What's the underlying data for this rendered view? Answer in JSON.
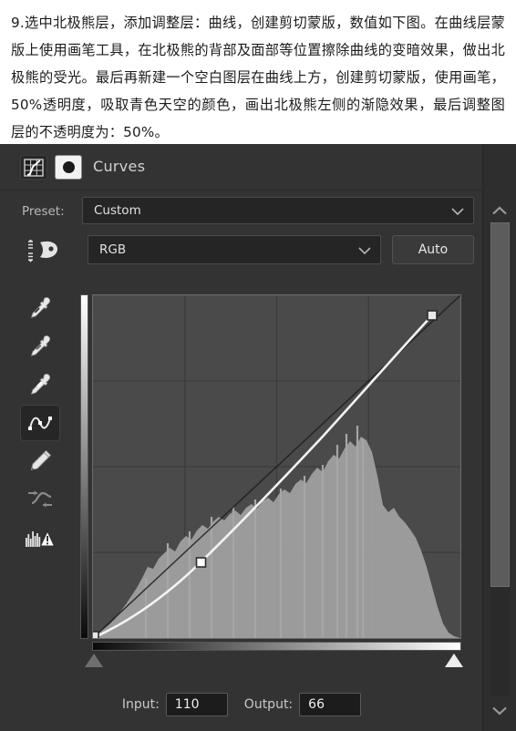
{
  "tutorial": {
    "body": "9.选中北极熊层，添加调整层：曲线，创建剪切蒙版，数值如下图。在曲线层蒙版上使用画笔工具，在北极熊的背部及面部等位置擦除曲线的变暗效果，做出北极熊的受光。最后再新建一个空白图层在曲线上方，创建剪切蒙版，使用画笔，50%透明度，吸取青色天空的颜色，画出北极熊左侧的渐隐效果，最后调整图层的不透明度为：50%。"
  },
  "panel": {
    "title": "Curves",
    "type_icon": "curves-adjustment-icon",
    "mask_thumb": "layer-mask-thumbnail"
  },
  "preset": {
    "label": "Preset:",
    "value": "Custom",
    "chevron": "chevron-down-icon"
  },
  "channel": {
    "icon": "curve-channel-icon",
    "value": "RGB",
    "chevron": "chevron-down-icon",
    "auto_label": "Auto"
  },
  "toolbar": {
    "tools": [
      {
        "name": "black-point-eyedropper-icon",
        "active": false
      },
      {
        "name": "gray-point-eyedropper-icon",
        "active": false
      },
      {
        "name": "white-point-eyedropper-icon",
        "active": false
      },
      {
        "name": "edit-points-curve-icon",
        "active": true
      },
      {
        "name": "pencil-draw-curve-icon",
        "active": false
      },
      {
        "name": "smooth-curve-icon",
        "active": false
      },
      {
        "name": "histogram-warning-icon",
        "active": false
      }
    ]
  },
  "graph": {
    "black_slider": "black-input-slider",
    "white_slider": "white-input-slider",
    "v_gradient": "output-gradient-bar",
    "h_gradient": "input-gradient-bar"
  },
  "io": {
    "input_label": "Input:",
    "input_value": "110",
    "output_label": "Output:",
    "output_value": "66"
  },
  "scrollbar": {
    "up": "chevron-up-icon",
    "down": "chevron-down-icon"
  },
  "colors": {
    "panel_bg": "#333333",
    "graph_bg": "#4a4a4a",
    "grid_line": "#3a3a3a",
    "curve_line": "#f2f2f2",
    "histogram": "#a8a8a8",
    "text": "#d2d2d2"
  },
  "chart_data": {
    "type": "line",
    "title": "Curves (RGB)",
    "xlabel": "Input",
    "ylabel": "Output",
    "xlim": [
      0,
      255
    ],
    "ylim": [
      0,
      255
    ],
    "grid": true,
    "grid_divisions": 4,
    "legend": "none",
    "series": [
      {
        "name": "baseline-diagonal",
        "points": [
          [
            0,
            0
          ],
          [
            255,
            255
          ]
        ]
      },
      {
        "name": "rgb-curve",
        "control_points": [
          [
            0,
            0
          ],
          [
            110,
            66
          ],
          [
            255,
            255
          ]
        ],
        "points": [
          [
            0,
            0
          ],
          [
            16,
            6
          ],
          [
            32,
            13
          ],
          [
            48,
            21
          ],
          [
            64,
            31
          ],
          [
            80,
            42
          ],
          [
            96,
            54
          ],
          [
            110,
            66
          ],
          [
            128,
            84
          ],
          [
            144,
            101
          ],
          [
            160,
            119
          ],
          [
            176,
            138
          ],
          [
            192,
            158
          ],
          [
            208,
            179
          ],
          [
            224,
            201
          ],
          [
            240,
            224
          ],
          [
            255,
            248
          ]
        ]
      }
    ],
    "histogram": {
      "name": "luminosity-histogram",
      "bins": 64,
      "values": [
        2,
        3,
        4,
        6,
        8,
        11,
        14,
        18,
        23,
        29,
        35,
        41,
        46,
        52,
        49,
        56,
        60,
        64,
        62,
        68,
        72,
        70,
        75,
        78,
        76,
        80,
        82,
        79,
        84,
        86,
        83,
        88,
        90,
        87,
        92,
        95,
        93,
        98,
        101,
        99,
        104,
        108,
        106,
        112,
        116,
        114,
        120,
        126,
        122,
        130,
        128,
        118,
        96,
        72,
        66,
        70,
        62,
        58,
        52,
        44,
        34,
        22,
        12,
        5
      ],
      "max": 130
    },
    "annotations": [
      {
        "label": "Input",
        "value": 110
      },
      {
        "label": "Output",
        "value": 66
      }
    ]
  }
}
